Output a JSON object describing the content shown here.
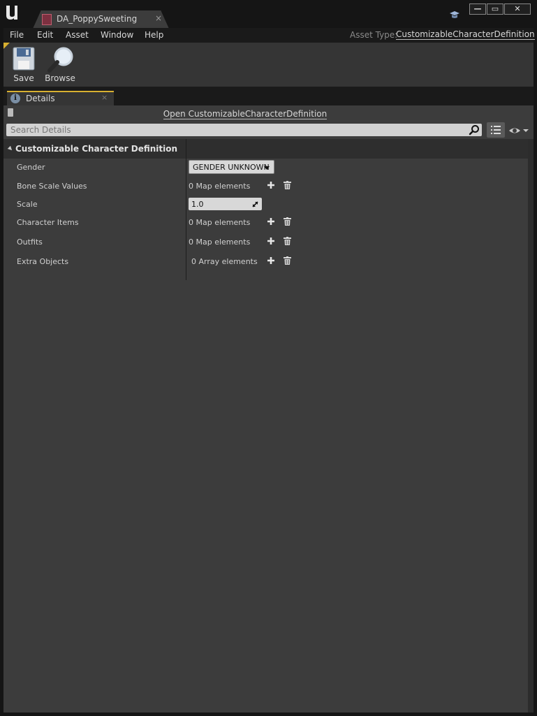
{
  "window": {
    "tab_title": "DA_PoppySweeting",
    "tab_close": "×",
    "min": "—",
    "max": "▭",
    "close": "✕"
  },
  "menu": {
    "items": [
      "File",
      "Edit",
      "Asset",
      "Window",
      "Help"
    ],
    "asset_type_label": "Asset Type:",
    "asset_type_value": "CustomizableCharacterDefinition"
  },
  "toolbar": {
    "save_label": "Save",
    "browse_label": "Browse"
  },
  "details": {
    "tab_label": "Details",
    "tab_close": "×",
    "info_glyph": "i",
    "open_link": "Open CustomizableCharacterDefinition",
    "search_placeholder": "Search Details",
    "category": "Customizable Character Definition",
    "properties": [
      {
        "name": "Gender",
        "kind": "combo",
        "value": "GENDER UNKNOWN"
      },
      {
        "name": "Bone Scale Values",
        "kind": "map",
        "value": "0 Map elements"
      },
      {
        "name": "Scale",
        "kind": "number",
        "value": "1.0"
      },
      {
        "name": "Character Items",
        "kind": "map",
        "value": "0 Map elements"
      },
      {
        "name": "Outfits",
        "kind": "map",
        "value": "0 Map elements"
      },
      {
        "name": "Extra Objects",
        "kind": "array",
        "value": "0 Array elements"
      }
    ]
  },
  "colors": {
    "accent": "#d8b030",
    "panel_bg": "#3c3c3c",
    "titlebar_bg": "#151515"
  },
  "icons": [
    "unreal-logo-icon",
    "data-asset-icon",
    "tutorial-hat-icon",
    "save-icon",
    "browse-icon",
    "info-icon",
    "lock-icon",
    "search-icon",
    "view-options-icon",
    "eye-icon",
    "add-icon",
    "trash-icon"
  ]
}
